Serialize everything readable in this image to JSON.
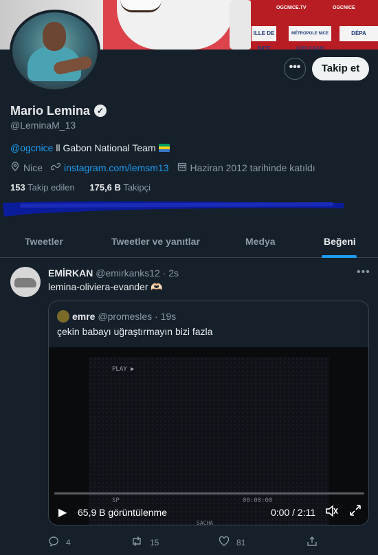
{
  "header": {
    "more_label": "•••",
    "follow_label": "Takip et"
  },
  "profile": {
    "name": "Mario Lemina",
    "handle": "@LeminaM_13",
    "bio_link": "@ogcnice",
    "bio_text": " ll Gabon National Team",
    "location": "Nice",
    "website": "instagram.com/lemsm13",
    "joined": "Haziran 2012 tarihinde katıldı",
    "following_count": "153",
    "following_label": "Takip edilen",
    "followers_count": "175,6 B",
    "followers_label": "Takipçi"
  },
  "tabs": [
    "Tweetler",
    "Tweetler ve yanıtlar",
    "Medya",
    "Beğeni"
  ],
  "tweet": {
    "name": "EMİRKAN",
    "handle": "@emirkanks12",
    "time": "· 2s",
    "text": "lemina-oliviera-evander 🫶🏻",
    "quote": {
      "name": "emre",
      "handle": "@promesles",
      "time": "· 19s",
      "text": "çekin babayı uğraştırmayın bizi fazla",
      "video": {
        "overlay_play": "PLAY ▶",
        "overlay_sp": "SP",
        "overlay_timecode": "00:00:00",
        "overlay_brand": "SACHA",
        "views": "65,9 B görüntülenme",
        "time": "0:00 / 2:11",
        "progress": 0
      }
    },
    "actions": {
      "replies": "4",
      "retweets": "15",
      "likes": "81"
    }
  },
  "banner": {
    "tag1": "OGCNICE.TV",
    "tag2": "OGCNICE",
    "panel1": "ILLE DE NICE",
    "panel2": "MÉTROPOLE NICE CÔTE D'AZUR",
    "panel3": "DÉPA"
  },
  "colors": {
    "background": "#15202b",
    "accent": "#1d9bf0",
    "muted": "#8b98a5"
  }
}
